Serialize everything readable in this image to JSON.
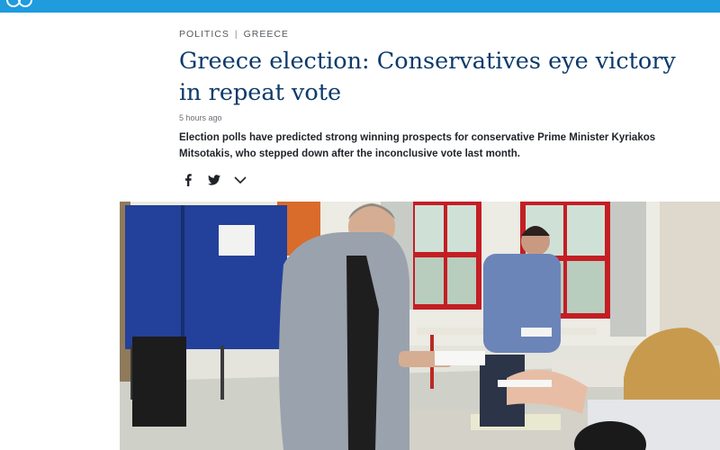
{
  "header": {
    "bar_color": "#1f9bde",
    "logo_icon": "dw-logo-icon"
  },
  "article": {
    "section": "POLITICS",
    "region": "GREECE",
    "separator": "|",
    "headline_line1": "Greece election: Conservatives eye victory",
    "headline_line2": "in repeat vote",
    "timestamp": "5 hours ago",
    "summary": "Election polls have predicted strong winning prospects for conservative Prime Minister Kyriakos Mitsotakis, who stepped down after the inconclusive vote last month.",
    "headline_color": "#0c3a6b"
  },
  "share": {
    "facebook_label": "f",
    "icons": [
      "facebook-icon",
      "twitter-icon",
      "chevron-down-icon"
    ]
  },
  "photo": {
    "description_icon": "election-photo"
  }
}
